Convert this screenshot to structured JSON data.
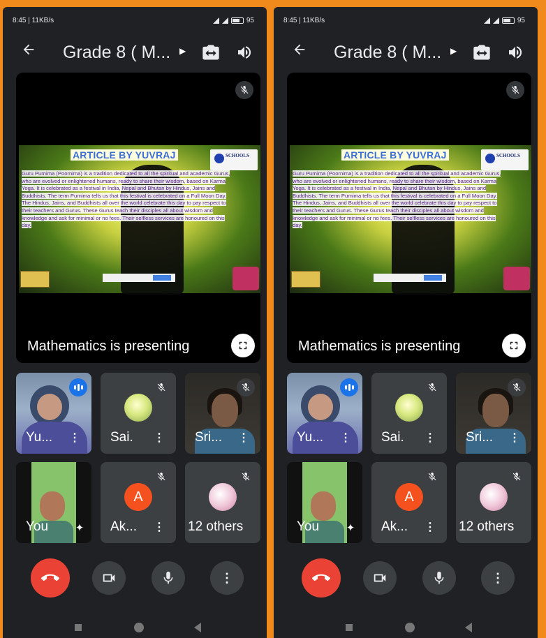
{
  "status_bar": {
    "time_speed": "8:45 | 11KB/s",
    "battery": "95"
  },
  "meeting": {
    "title": "Grade 8 ( M...",
    "presenting_label": "Mathematics is presenting"
  },
  "slide": {
    "title": "ARTICLE BY YUVRAJ",
    "logo_text": "SCHOOLS",
    "paragraph": "Guru Purnima (Poornima) is a tradition dedicated to all the spiritual and academic Gurus, who are evolved or enlightened humans, ready to share their wisdom, based on Karma Yoga. It is celebrated as a festival in India, Nepal and Bhutan by Hindus, Jains and Buddhists. The term Purnima tells us that this festival is celebrated on a Full Moon Day. The Hindus, Jains, and Buddhists all over the world celebrate this day to pay respect to their teachers and Gurus. These Gurus teach their disciples all about wisdom and knowledge and ask for minimal or no fees. Their selfless services are honoured on this day."
  },
  "participants": [
    {
      "name": "Yu...",
      "speaking": true
    },
    {
      "name": "Sai.",
      "muted": true
    },
    {
      "name": "Sri...",
      "muted": true
    },
    {
      "name": "You"
    },
    {
      "name": "Ak...",
      "avatar_letter": "A",
      "avatar_color": "#f4511e",
      "muted": true
    },
    {
      "name": "12 others",
      "muted": true
    }
  ],
  "colors": {
    "end_call": "#ea4335",
    "speaking": "#1a73e8",
    "background": "#f08a1c",
    "app_bg": "#202124"
  },
  "icons": [
    "back-arrow-icon",
    "chevron-right-icon",
    "camera-switch-icon",
    "speaker-icon",
    "mic-off-icon",
    "fullscreen-icon",
    "speaking-icon",
    "more-vert-icon",
    "effects-sparkle-icon",
    "end-call-icon",
    "video-camera-icon",
    "microphone-icon",
    "nav-recents-icon",
    "nav-home-icon",
    "nav-back-icon"
  ]
}
